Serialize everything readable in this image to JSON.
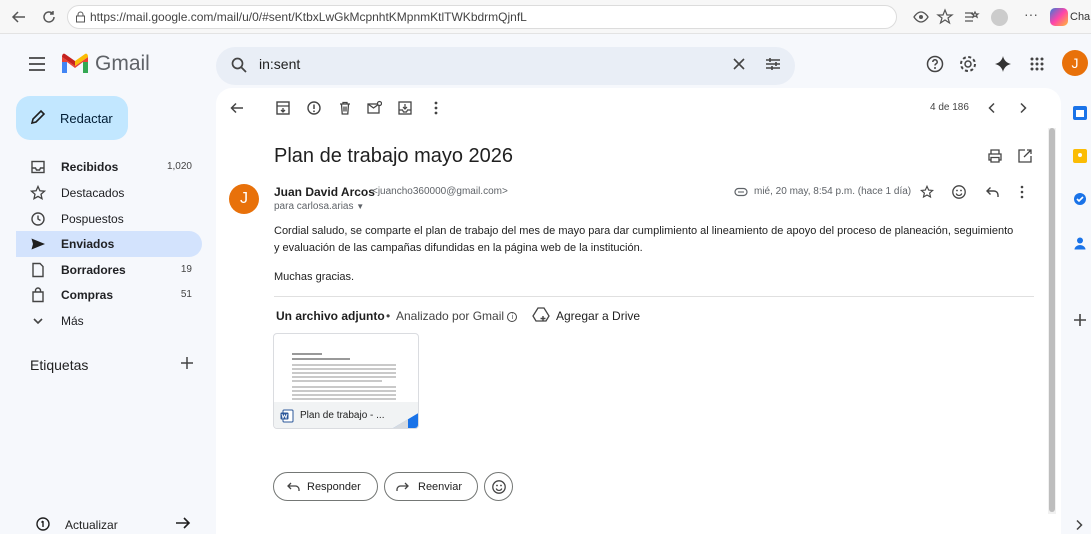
{
  "browser": {
    "url": "https://mail.google.com/mail/u/0/#sent/KtbxLwGkMcpnhtKMpnmKtlTWKbdrmQjnfL",
    "extension_label": "Cha"
  },
  "header": {
    "app_name": "Gmail",
    "search_value": "in:sent",
    "avatar_letter": "J"
  },
  "sidebar": {
    "compose_label": "Redactar",
    "items": [
      {
        "label": "Recibidos",
        "count": "1,020",
        "icon": "inbox-icon"
      },
      {
        "label": "Destacados",
        "count": "",
        "icon": "star-icon"
      },
      {
        "label": "Pospuestos",
        "count": "",
        "icon": "clock-icon"
      },
      {
        "label": "Enviados",
        "count": "",
        "icon": "send-icon"
      },
      {
        "label": "Borradores",
        "count": "19",
        "icon": "draft-icon"
      },
      {
        "label": "Compras",
        "count": "51",
        "icon": "shopping-icon"
      },
      {
        "label": "Más",
        "count": "",
        "icon": "chevron-down-icon"
      }
    ],
    "labels_heading": "Etiquetas",
    "update_label": "Actualizar"
  },
  "toolbar": {
    "pagination": "4 de 186"
  },
  "email": {
    "subject": "Plan de trabajo mayo 2026",
    "sender_name": "Juan David Arcos",
    "sender_email": "<juancho360000@gmail.com>",
    "sender_initial": "J",
    "to_line": "para carlosa.arias",
    "date": "mié, 20 may, 8:54 p.m. (hace 1 día)",
    "body_paragraph": "Cordial saludo, se comparte el plan de trabajo del mes de mayo para dar cumplimiento al lineamiento de apoyo del proceso de planeación, seguimiento y evaluación de las campañas difundidas en la página web de la institución.",
    "closing": "Muchas gracias."
  },
  "attachments": {
    "count_label": "Un archivo adjunto",
    "separator": "•",
    "scanned_label": "Analizado por Gmail",
    "drive_label": "Agregar a Drive",
    "file_name": "Plan de trabajo - ..."
  },
  "actions": {
    "reply": "Responder",
    "forward": "Reenviar"
  },
  "colors": {
    "accent": "#0b57d0",
    "avatar": "#e8710a",
    "compose_bg": "#c2e7ff",
    "active_nav": "#d3e3fd"
  }
}
